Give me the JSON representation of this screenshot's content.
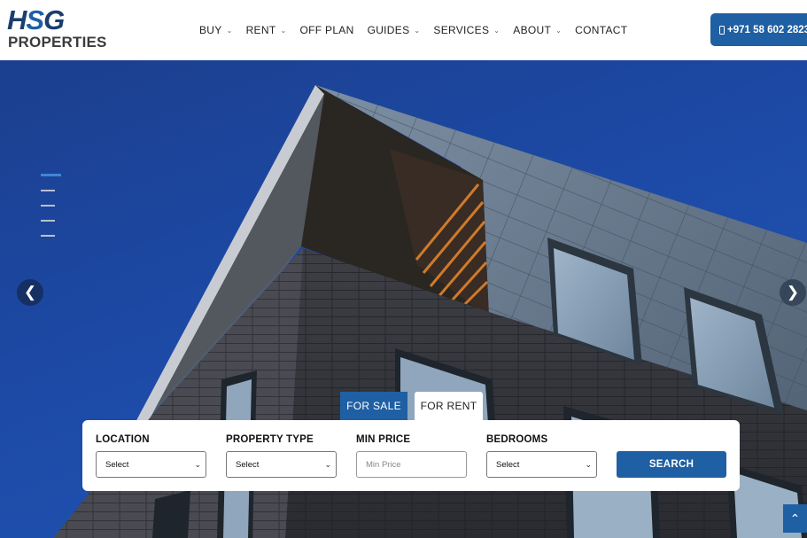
{
  "brand": {
    "logo_main": "HSG",
    "logo_sub": "PROPERTIES"
  },
  "nav": {
    "items": [
      {
        "label": "BUY",
        "has_dropdown": true
      },
      {
        "label": "RENT",
        "has_dropdown": true
      },
      {
        "label": "OFF PLAN",
        "has_dropdown": false
      },
      {
        "label": "GUIDES",
        "has_dropdown": true
      },
      {
        "label": "SERVICES",
        "has_dropdown": true
      },
      {
        "label": "ABOUT",
        "has_dropdown": true
      },
      {
        "label": "CONTACT",
        "has_dropdown": false
      }
    ],
    "dropdown_icon": "chevron-down-icon"
  },
  "phone": {
    "label": "+971 58 602 2823",
    "icon": "mobile-phone-icon"
  },
  "hero": {
    "slide_count": 5,
    "active_slide": 1,
    "prev_label": "❮",
    "next_label": "❯"
  },
  "search": {
    "tabs": [
      {
        "label": "FOR SALE",
        "active": true
      },
      {
        "label": "FOR RENT",
        "active": false
      }
    ],
    "fields": {
      "location": {
        "label": "LOCATION",
        "value": "Select"
      },
      "property_type": {
        "label": "PROPERTY TYPE",
        "value": "Select"
      },
      "min_price": {
        "label": "MIN PRICE",
        "placeholder": "Min Price"
      },
      "bedrooms": {
        "label": "BEDROOMS",
        "value": "Select"
      }
    },
    "button_label": "SEARCH"
  },
  "colors": {
    "brand_blue": "#1f5fa3",
    "logo_navy": "#1a3e6e"
  }
}
